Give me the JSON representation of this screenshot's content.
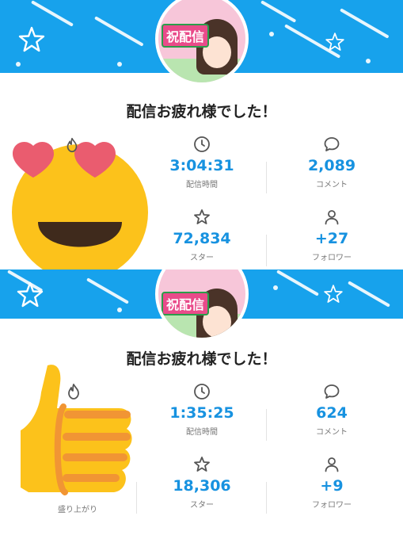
{
  "panels": [
    {
      "title": "配信お疲れ様でした！",
      "avatar_tag": "祝配信",
      "stats": [
        {
          "icon": "flame-icon",
          "value": "",
          "label": ""
        },
        {
          "icon": "clock-icon",
          "value": "3:04:31",
          "label": "配信時間"
        },
        {
          "icon": "comment-icon",
          "value": "2,089",
          "label": "コメント"
        },
        {
          "icon": "star-icon",
          "value": "",
          "label": ""
        },
        {
          "icon": "star-icon",
          "value": "72,834",
          "label": "スター"
        },
        {
          "icon": "person-icon",
          "value": "+27",
          "label": "フォロワー"
        }
      ]
    },
    {
      "title": "配信お疲れ様でした！",
      "avatar_tag": "祝配信",
      "stats": [
        {
          "icon": "flame-icon",
          "value": "",
          "label": ""
        },
        {
          "icon": "clock-icon",
          "value": "1:35:25",
          "label": "配信時間"
        },
        {
          "icon": "comment-icon",
          "value": "624",
          "label": "コメント"
        },
        {
          "icon": "star-icon",
          "value": "",
          "label": "盛り上がり"
        },
        {
          "icon": "star-icon",
          "value": "18,306",
          "label": "スター"
        },
        {
          "icon": "person-icon",
          "value": "+9",
          "label": "フォロワー"
        }
      ]
    }
  ],
  "colors": {
    "banner": "#17a2ec",
    "accent": "#1792e0"
  }
}
